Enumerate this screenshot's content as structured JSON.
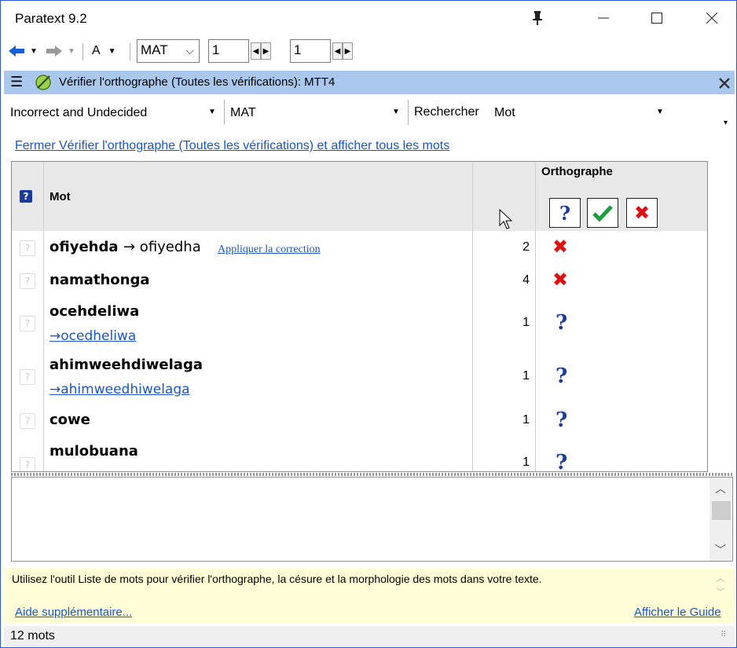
{
  "window": {
    "title": "Paratext 9.2"
  },
  "toolbar": {
    "font_label": "A",
    "book": "MAT",
    "chapter": "1",
    "verse": "1"
  },
  "panel": {
    "title": "Vérifier l'orthographe (Toutes les vérifications): MTT4"
  },
  "filters": {
    "status_filter": "Incorrect and Undecided",
    "book_filter": "MAT",
    "search_label": "Rechercher",
    "search_field": "Mot"
  },
  "close_link": "Fermer Vérifier l'orthographe (Toutes les vérifications) et afficher tous les mots",
  "grid": {
    "col_word": "Mot",
    "col_spelling": "Orthographe",
    "rows": [
      {
        "word": "ofiyehda",
        "arrow_text": "→ ofiyedha",
        "apply": "Appliquer la correction",
        "count": "2",
        "status": "incorrect"
      },
      {
        "word": "namathonga",
        "count": "4",
        "status": "incorrect"
      },
      {
        "word": "ocehdeliwa",
        "suggestion": "→ocedheliwa",
        "count": "1",
        "status": "undecided"
      },
      {
        "word": "ahimweehdiwelaga",
        "suggestion": "→ahimweedhiwelaga",
        "count": "1",
        "status": "undecided"
      },
      {
        "word": "cowe",
        "count": "1",
        "status": "undecided"
      },
      {
        "word": "mulobuana",
        "count": "1",
        "status": "undecided"
      }
    ]
  },
  "info": {
    "text": "Utilisez l'outil Liste de mots pour vérifier l'orthographe, la césure et la morphologie des mots dans votre texte.",
    "help_link": "Aide supplémentaire...",
    "guide_link": "Afficher le Guide"
  },
  "status": {
    "count": "12 mots"
  },
  "colors": {
    "header_bar": "#aac8ee",
    "info_bg": "#fffed6",
    "link": "#1a55c8",
    "incorrect": "#d11111",
    "undecided": "#1c3c9c",
    "correct": "#19a03a"
  }
}
